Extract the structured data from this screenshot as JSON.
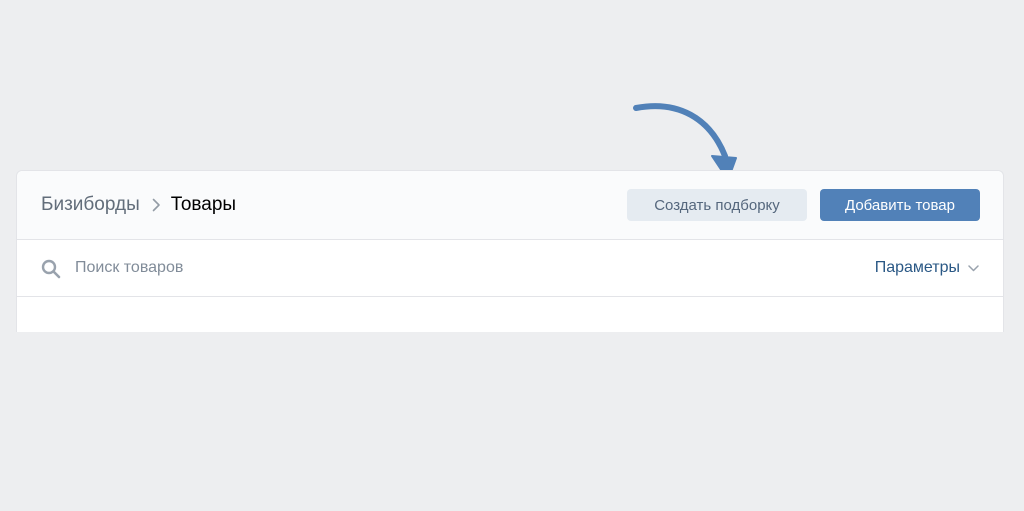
{
  "colors": {
    "page_background": "#edeef0",
    "card_background": "#ffffff",
    "header_background": "#fafbfc",
    "primary_button": "#5181b8",
    "secondary_button": "#e5ebf1",
    "link": "#2a5885",
    "annotation_arrow": "#5181b8"
  },
  "breadcrumb": {
    "parent": "Бизиборды",
    "current": "Товары",
    "separator_icon": "chevron-right-icon"
  },
  "toolbar": {
    "create_collection_label": "Создать подборку",
    "add_product_label": "Добавить товар"
  },
  "search": {
    "placeholder": "Поиск товаров",
    "value": "",
    "icon": "search-icon"
  },
  "filters": {
    "params_label": "Параметры",
    "params_icon": "chevron-down-icon"
  },
  "annotation": {
    "icon": "curved-arrow-icon",
    "points_to": "Создать подборку"
  }
}
